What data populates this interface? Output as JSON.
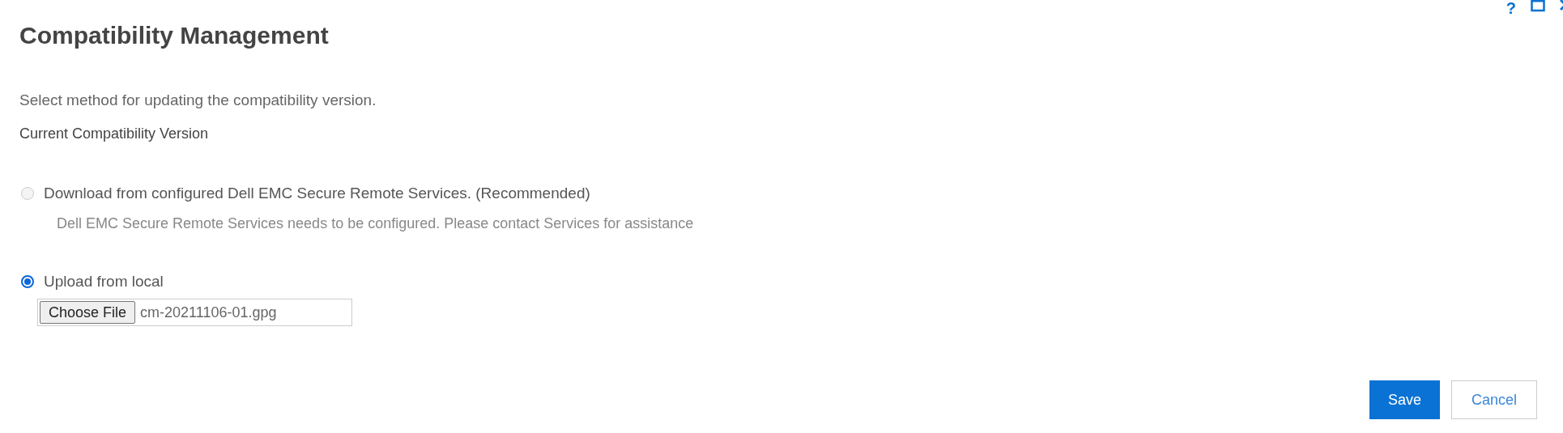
{
  "window": {
    "help": "?",
    "title": "Compatibility Management"
  },
  "description": "Select method for updating the compatibility version.",
  "current_version_label": "Current Compatibility Version",
  "options": [
    {
      "label": "Download from configured Dell EMC Secure Remote Services. (Recommended)",
      "selected": false,
      "disabled": true,
      "note": "Dell EMC Secure Remote Services needs to be configured. Please contact Services for assistance"
    },
    {
      "label": "Upload from local",
      "selected": true,
      "disabled": false,
      "file_button": "Choose File",
      "file_name": "cm-20211106-01.gpg"
    }
  ],
  "buttons": [
    {
      "label": "Save",
      "kind": "primary"
    },
    {
      "label": "Cancel",
      "kind": "secondary"
    }
  ]
}
